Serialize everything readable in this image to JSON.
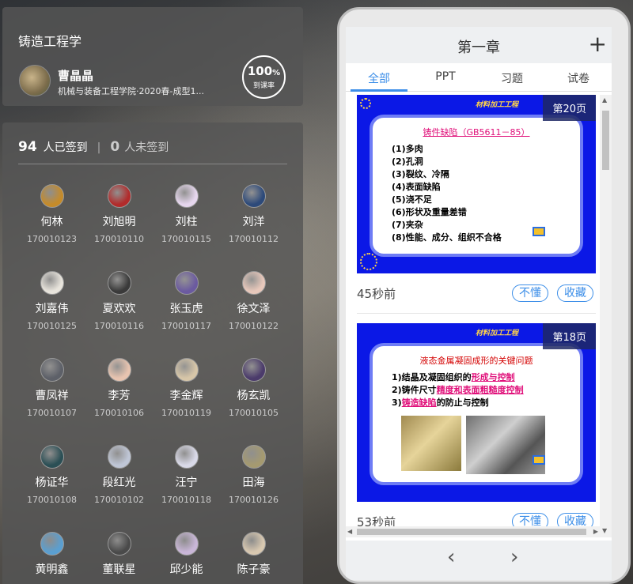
{
  "course": {
    "title": "铸造工程学",
    "teacher_name": "曹晶晶",
    "teacher_dept": "机械与装备工程学院·2020春-成型1...",
    "rate_value": "100",
    "rate_unit": "%",
    "rate_label": "到课率"
  },
  "attendance": {
    "signed_count": "94",
    "signed_label": "人已签到",
    "separator": "|",
    "unsigned_count": "0",
    "unsigned_label": "人未签到"
  },
  "students": [
    {
      "name": "何林",
      "id": "170010123",
      "color": "#c58b2a"
    },
    {
      "name": "刘旭明",
      "id": "170010110",
      "color": "#b22b2b"
    },
    {
      "name": "刘柱",
      "id": "170010115",
      "color": "#e6d6ee"
    },
    {
      "name": "刘洋",
      "id": "170010112",
      "color": "#2d4a7a"
    },
    {
      "name": "刘嘉伟",
      "id": "170010125",
      "color": "#e8e4dc"
    },
    {
      "name": "夏欢欢",
      "id": "170010116",
      "color": "#3a3a3a"
    },
    {
      "name": "张玉虎",
      "id": "170010117",
      "color": "#6b5aa0"
    },
    {
      "name": "徐文泽",
      "id": "170010122",
      "color": "#e8c8bb"
    },
    {
      "name": "曹凤祥",
      "id": "170010107",
      "color": "#5d6068"
    },
    {
      "name": "李芳",
      "id": "170010106",
      "color": "#e8c4b0"
    },
    {
      "name": "李金辉",
      "id": "170010119",
      "color": "#d7c6a8"
    },
    {
      "name": "杨玄凯",
      "id": "170010105",
      "color": "#4b3b6b"
    },
    {
      "name": "杨证华",
      "id": "170010108",
      "color": "#2b4f55"
    },
    {
      "name": "段红光",
      "id": "170010102",
      "color": "#bfc6d6"
    },
    {
      "name": "汪宁",
      "id": "170010118",
      "color": "#d9d9e8"
    },
    {
      "name": "田海",
      "id": "170010126",
      "color": "#a59a70"
    },
    {
      "name": "黄明鑫",
      "id": "",
      "color": "#5a9fd1"
    },
    {
      "name": "董联星",
      "id": "",
      "color": "#4a4a4a"
    },
    {
      "name": "邱少能",
      "id": "",
      "color": "#c9b6d8"
    },
    {
      "name": "陈子豪",
      "id": "",
      "color": "#d8c8b0"
    }
  ],
  "phone": {
    "chapter_title": "第一章",
    "plus_icon": "+",
    "tabs": [
      "全部",
      "PPT",
      "习题",
      "试卷"
    ],
    "slides": [
      {
        "page_badge": "第20页",
        "banner": "材料加工工程",
        "heading": "铸件缺陷（GB5611－85）",
        "items": [
          "(1)多肉",
          "(2)孔洞",
          "(3)裂纹、冷隔",
          "(4)表面缺陷",
          "(5)浇不足",
          "(6)形状及重量差错",
          "(7)夹杂",
          "(8)性能、成分、组织不合格"
        ],
        "time": "45秒前",
        "btn_confused": "不懂",
        "btn_fav": "收藏"
      },
      {
        "page_badge": "第18页",
        "banner": "材料加工工程",
        "heading": "液态金属凝固成形的关键问题",
        "item1_pre": "1)结晶及凝固组织的",
        "item1_link": "形成与控制",
        "item2_pre": "2)铸件尺寸",
        "item2_link": "精度和表面粗糙度控制",
        "item3_pre": "3)",
        "item3_link": "铸造缺陷",
        "item3_post": "的防止与控制",
        "time": "53秒前",
        "btn_confused": "不懂",
        "btn_fav": "收藏"
      }
    ],
    "nav_prev": "‹",
    "nav_next": "›"
  }
}
